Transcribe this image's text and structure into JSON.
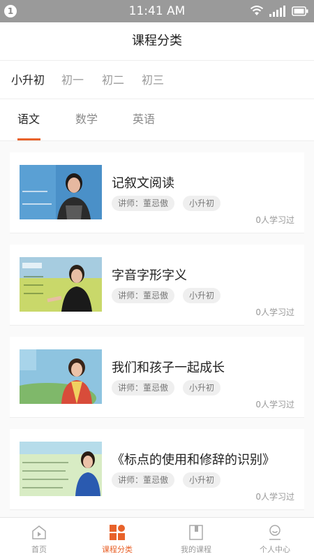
{
  "status": {
    "notification_count": "1",
    "time": "11:41 AM"
  },
  "header": {
    "title": "课程分类"
  },
  "grade_tabs": [
    {
      "label": "小升初",
      "active": true
    },
    {
      "label": "初一",
      "active": false
    },
    {
      "label": "初二",
      "active": false
    },
    {
      "label": "初三",
      "active": false
    }
  ],
  "subject_tabs": [
    {
      "label": "语文",
      "active": true
    },
    {
      "label": "数学",
      "active": false
    },
    {
      "label": "英语",
      "active": false
    }
  ],
  "courses": [
    {
      "title": "记叙文阅读",
      "teacher": "讲师：董忌傲",
      "level": "小升初",
      "learned": "0人学习过"
    },
    {
      "title": "字音字形字义",
      "teacher": "讲师：董忌傲",
      "level": "小升初",
      "learned": "0人学习过"
    },
    {
      "title": "我们和孩子一起成长",
      "teacher": "讲师：董忌傲",
      "level": "小升初",
      "learned": "0人学习过"
    },
    {
      "title": "《标点的使用和修辞的识别》",
      "teacher": "讲师：董忌傲",
      "level": "小升初",
      "learned": "0人学习过"
    }
  ],
  "bottom_nav": [
    {
      "label": "首页",
      "icon": "home-play-icon",
      "active": false
    },
    {
      "label": "课程分类",
      "icon": "category-grid-icon",
      "active": true
    },
    {
      "label": "我的课程",
      "icon": "book-icon",
      "active": false
    },
    {
      "label": "个人中心",
      "icon": "user-icon",
      "active": false
    }
  ],
  "colors": {
    "accent": "#e8622a",
    "status_bar": "#9a9a9a",
    "inactive_text": "#999999"
  }
}
